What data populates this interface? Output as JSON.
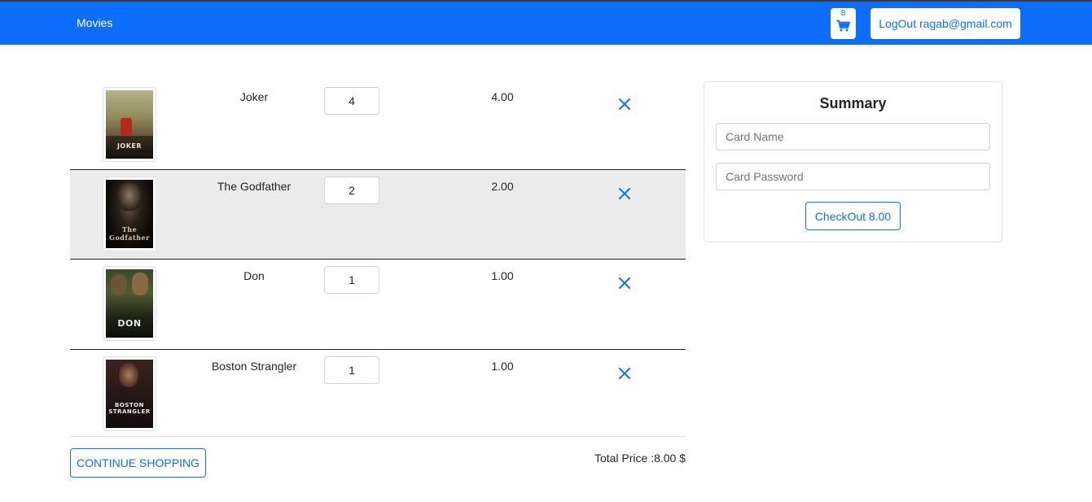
{
  "navbar": {
    "brand": "Movies",
    "cart_count": "8",
    "logout_label": "LogOut ragab@gmail.com"
  },
  "cart": {
    "items": [
      {
        "title": "Joker",
        "quantity": "4",
        "price": "4.00",
        "poster_text": "JOKER"
      },
      {
        "title": "The Godfather",
        "quantity": "2",
        "price": "2.00",
        "poster_text": "The Godfather"
      },
      {
        "title": "Don",
        "quantity": "1",
        "price": "1.00",
        "poster_text": "DON"
      },
      {
        "title": "Boston Strangler",
        "quantity": "1",
        "price": "1.00",
        "poster_text": "BOSTON STRANGLER"
      }
    ],
    "continue_label": "CONTINUE SHOPPING",
    "total_label": "Total Price :8.00 $"
  },
  "summary": {
    "title": "Summary",
    "card_name_placeholder": "Card Name",
    "card_password_placeholder": "Card Password",
    "checkout_label": "CheckOut 8.00"
  },
  "colors": {
    "primary": "#0d6efd",
    "row_highlight": "#ebebeb"
  }
}
